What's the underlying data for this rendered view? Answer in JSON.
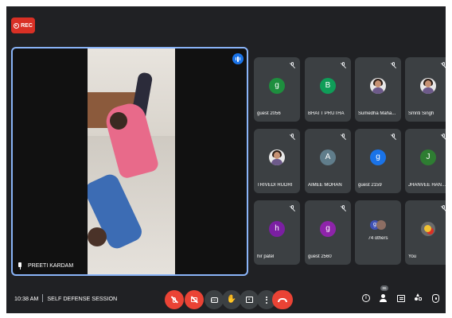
{
  "recording": {
    "label": "REC",
    "color": "#d93025"
  },
  "main_tile": {
    "name": "PREETI KARDAM",
    "border_color": "#8ab4f8",
    "speaking_icon": "audio-speaking-icon",
    "pin_icon": "pin-icon"
  },
  "participants": [
    {
      "name": "guest 2056",
      "initial": "g",
      "avatar_color": "#1e8e3e",
      "type": "letter",
      "muted": true
    },
    {
      "name": "BHATT PRUTHA",
      "initial": "B",
      "avatar_color": "#0f9d58",
      "type": "letter",
      "muted": true
    },
    {
      "name": "Sumedha Maha...",
      "initial": "",
      "avatar_color": "",
      "type": "photo",
      "muted": true
    },
    {
      "name": "Smriti Singh",
      "initial": "",
      "avatar_color": "",
      "type": "photo",
      "muted": true
    },
    {
      "name": "TRIVEDI RUDRI",
      "initial": "",
      "avatar_color": "",
      "type": "photo",
      "muted": true
    },
    {
      "name": "AIMEE MOHAN",
      "initial": "A",
      "avatar_color": "#607d8b",
      "type": "letter",
      "muted": true
    },
    {
      "name": "guest 2159",
      "initial": "g",
      "avatar_color": "#1a73e8",
      "type": "letter",
      "muted": true
    },
    {
      "name": "JHANVEE HAN...",
      "initial": "J",
      "avatar_color": "#2e7d32",
      "type": "letter",
      "muted": true
    },
    {
      "name": "hir patel",
      "initial": "h",
      "avatar_color": "#7b1fa2",
      "type": "letter",
      "muted": true
    },
    {
      "name": "guest 2560",
      "initial": "g",
      "avatar_color": "#8e24aa",
      "type": "letter",
      "muted": true
    },
    {
      "name": "74 others",
      "initial": "g",
      "avatar_color": "#3f51b5",
      "type": "others",
      "muted": false
    },
    {
      "name": "You",
      "initial": "",
      "avatar_color": "",
      "type": "you",
      "muted": true
    }
  ],
  "meeting": {
    "time": "10:38 AM",
    "title": "SELF DEFENSE SESSION"
  },
  "controls": [
    {
      "name": "mic-off-button",
      "icon": "mic-off-icon",
      "style": "red"
    },
    {
      "name": "camera-off-button",
      "icon": "camera-off-icon",
      "style": "red"
    },
    {
      "name": "captions-button",
      "icon": "captions-icon",
      "style": "grey"
    },
    {
      "name": "raise-hand-button",
      "icon": "hand-icon",
      "style": "grey"
    },
    {
      "name": "present-button",
      "icon": "present-icon",
      "style": "grey"
    },
    {
      "name": "more-options-button",
      "icon": "more-vert-icon",
      "style": "grey"
    },
    {
      "name": "leave-call-button",
      "icon": "call-end-icon",
      "style": "hang"
    }
  ],
  "right_controls": {
    "participant_count": "86",
    "icons": [
      "info-icon",
      "people-icon",
      "chat-icon",
      "activities-icon",
      "host-controls-icon"
    ]
  }
}
